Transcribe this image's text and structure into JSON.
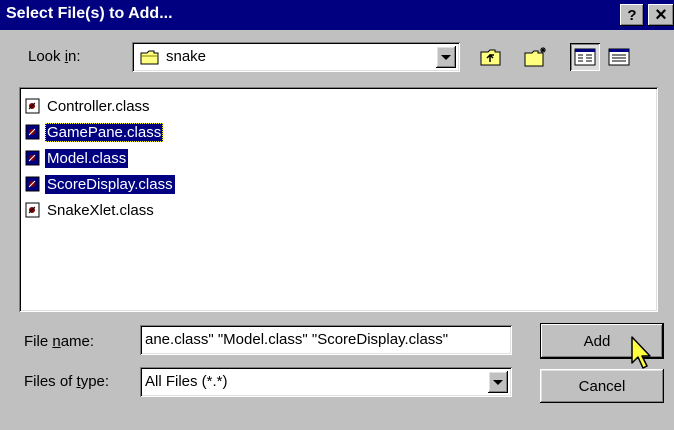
{
  "title": "Select File(s) to Add...",
  "title_buttons": {
    "help": "?",
    "close": "×"
  },
  "look_in": {
    "label_pre": "Look ",
    "label_key": "i",
    "label_post": "n:",
    "value": "snake",
    "folder_icon": "folder-icon"
  },
  "toolbar": {
    "up_icon": "up-folder-icon",
    "new_folder_icon": "new-folder-icon",
    "list_view_icon": "list-view-icon",
    "details_view_icon": "details-view-icon"
  },
  "files": [
    {
      "name": "Controller.class",
      "selected": false,
      "focused": false
    },
    {
      "name": "GamePane.class",
      "selected": true,
      "focused": true
    },
    {
      "name": "Model.class",
      "selected": true,
      "focused": false
    },
    {
      "name": "ScoreDisplay.class",
      "selected": true,
      "focused": false
    },
    {
      "name": "SnakeXlet.class",
      "selected": false,
      "focused": false
    }
  ],
  "file_name": {
    "label_pre": "File ",
    "label_key": "n",
    "label_post": "ame:",
    "value": "ane.class\" \"Model.class\" \"ScoreDisplay.class\""
  },
  "files_of_type": {
    "label_pre": "Files of ",
    "label_key": "t",
    "label_post": "ype:",
    "value": "All Files (*.*)"
  },
  "buttons": {
    "add": "Add",
    "cancel": "Cancel"
  },
  "colors": {
    "face": "#c0c0c0",
    "titlebar": "#000080",
    "selection": "#000080"
  }
}
